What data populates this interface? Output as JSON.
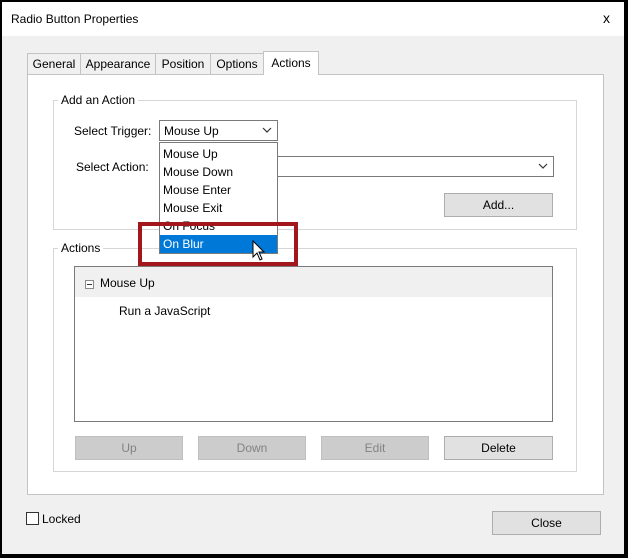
{
  "window": {
    "title": "Radio Button Properties",
    "close_glyph": "x"
  },
  "tabs": [
    {
      "label": "General"
    },
    {
      "label": "Appearance"
    },
    {
      "label": "Position"
    },
    {
      "label": "Options"
    },
    {
      "label": "Actions"
    }
  ],
  "active_tab": "Actions",
  "add_action": {
    "group_label": "Add an Action",
    "trigger_label": "Select Trigger:",
    "trigger_value": "Mouse Up",
    "action_label": "Select Action:",
    "action_value": "",
    "add_button": "Add..."
  },
  "trigger_dropdown": {
    "options": [
      "Mouse Up",
      "Mouse Down",
      "Mouse Enter",
      "Mouse Exit",
      "On Focus",
      "On Blur"
    ],
    "selected": "On Blur"
  },
  "actions": {
    "group_label": "Actions",
    "list_header": "Mouse Up",
    "items": [
      "Run a JavaScript"
    ],
    "buttons": {
      "up": "Up",
      "down": "Down",
      "edit": "Edit",
      "delete": "Delete"
    }
  },
  "footer": {
    "locked_label": "Locked",
    "close_button": "Close"
  },
  "colors": {
    "selected_bg": "#0078d7",
    "highlight_border": "#a3161d",
    "window_bg": "#f0f0f0"
  },
  "icons": {
    "close": "close-icon",
    "dropdown": "chevron-down-icon",
    "collapse": "collapse-minus-icon",
    "cursor": "mouse-pointer-icon"
  }
}
